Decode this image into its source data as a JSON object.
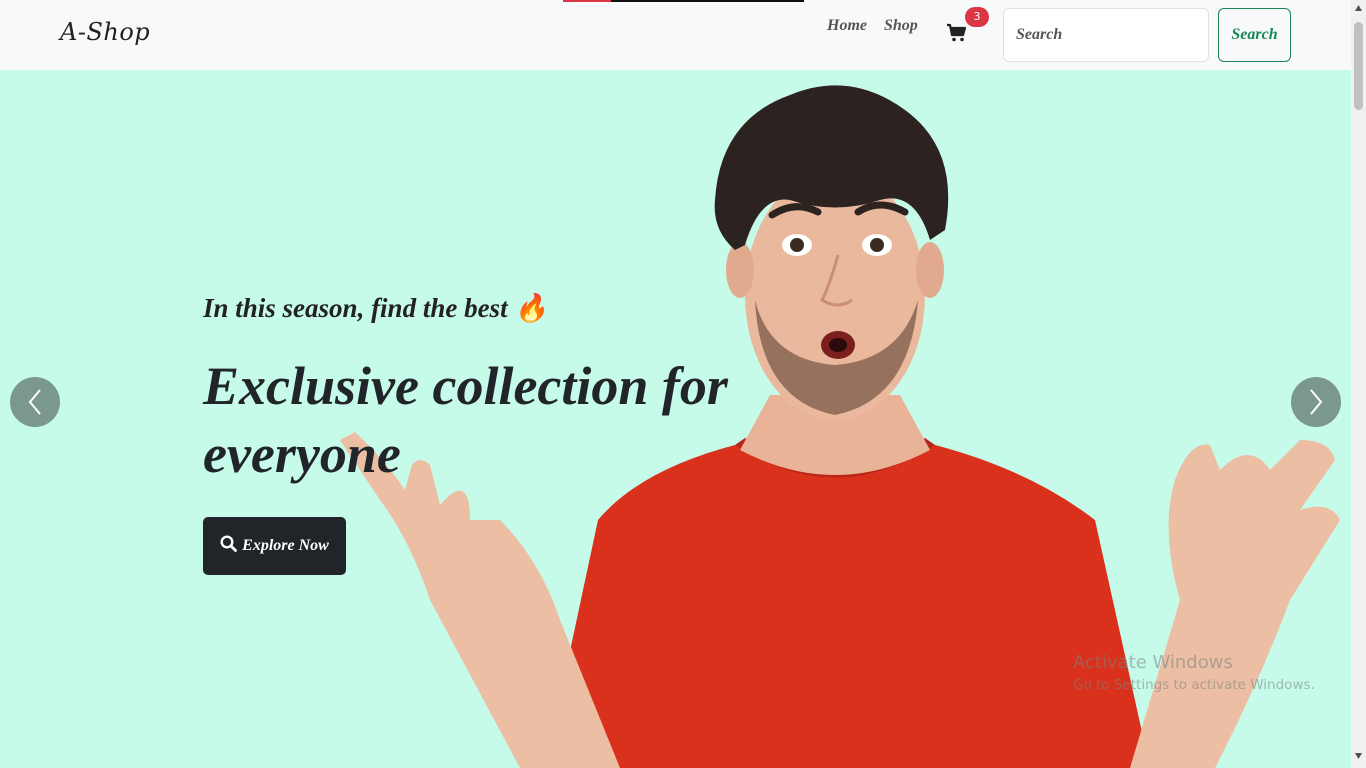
{
  "navbar": {
    "brand": "A-Shop",
    "links": [
      {
        "label": "Home"
      },
      {
        "label": "Shop"
      }
    ],
    "cart": {
      "icon": "cart-icon",
      "count": "3"
    },
    "search": {
      "placeholder": "Search",
      "button_label": "Search"
    }
  },
  "hero": {
    "subtitle": "In this season, find the best",
    "subtitle_emoji": "🔥",
    "title": "Exclusive collection for everyone",
    "cta_label": "Explore Now",
    "cta_icon": "search-icon",
    "prev_icon": "chevron-left-icon",
    "next_icon": "chevron-right-icon"
  },
  "watermark": {
    "line1": "Activate Windows",
    "line2": "Go to Settings to activate Windows."
  },
  "colors": {
    "hero_bg": "#c6fbea",
    "badge": "#dc3545",
    "search_button": "#198754",
    "cta_bg": "#212529",
    "shirt": "#d9311c"
  }
}
